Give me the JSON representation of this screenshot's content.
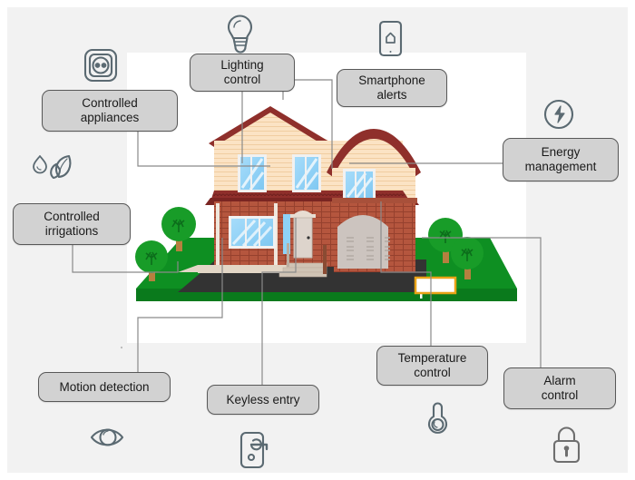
{
  "diagram": {
    "title": "Smart home control systems diagram",
    "canvas_bg": "#f2f2f2",
    "plate_bg": "#ffffff",
    "chip_fill": "#d2d2d2",
    "chip_border": "#585858",
    "connector_color": "#8a8a8a",
    "icon_color": "#5b6a72"
  },
  "nodes": [
    {
      "id": "controlled-appliances",
      "label": "Controlled\nappliances",
      "icon": "power-outlet-icon"
    },
    {
      "id": "lighting-control",
      "label": "Lighting\ncontrol",
      "icon": "light-bulb-icon"
    },
    {
      "id": "smartphone-alerts",
      "label": "Smartphone\nalerts",
      "icon": "smartphone-icon"
    },
    {
      "id": "energy-management",
      "label": "Energy\nmanagement",
      "icon": "energy-bolt-icon"
    },
    {
      "id": "controlled-irrigations",
      "label": "Controlled\nirrigations",
      "icon": "water-leaf-icon"
    },
    {
      "id": "motion-detection",
      "label": "Motion detection",
      "icon": "eye-icon"
    },
    {
      "id": "keyless-entry",
      "label": "Keyless entry",
      "icon": "door-handle-icon"
    },
    {
      "id": "temperature-control",
      "label": "Temperature\ncontrol",
      "icon": "thermometer-icon"
    },
    {
      "id": "alarm-control",
      "label": "Alarm\ncontrol",
      "icon": "padlock-icon"
    }
  ],
  "house": {
    "siding": "#fbe3c4",
    "siding_stripe": "#f3d2a8",
    "roof": "#8f2f2b",
    "roof_dark": "#7a2522",
    "brick": "#b5563e",
    "brick_line": "#9c4733",
    "window_glass": "#8ed2f7",
    "window_frame": "#efefef",
    "door": "#ddd4cc",
    "garage": "#ccc4bf",
    "lawn": "#0e8f22",
    "lawn_dark": "#0a6d18",
    "driveway": "#333333",
    "porch": "#e2d6c6",
    "stairs": "#cfc3b4",
    "tree_leaf": "#189c28",
    "tree_trunk": "#b5803f",
    "sign_border": "#e8a317"
  }
}
